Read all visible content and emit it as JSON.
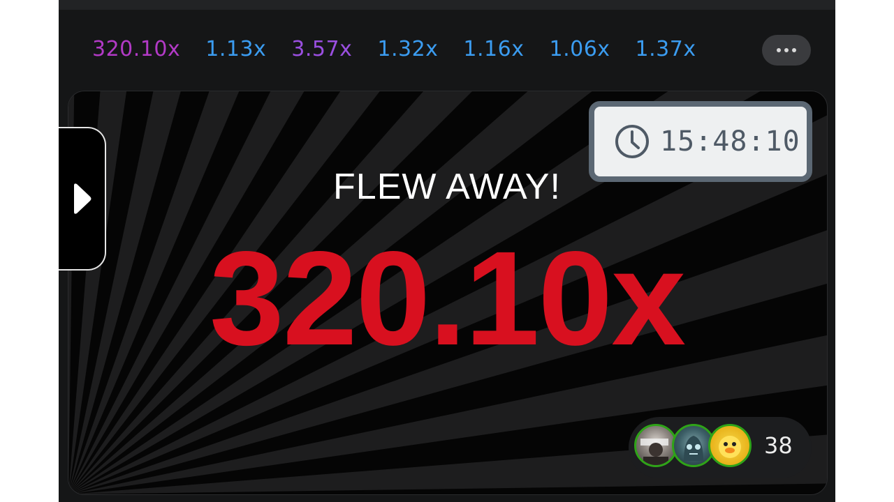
{
  "history": {
    "items": [
      {
        "value": "320.10x",
        "color": "#b23ac6"
      },
      {
        "value": "1.13x",
        "color": "#3b9cf0"
      },
      {
        "value": "3.57x",
        "color": "#9a4fe0"
      },
      {
        "value": "1.32x",
        "color": "#3b9cf0"
      },
      {
        "value": "1.16x",
        "color": "#3b9cf0"
      },
      {
        "value": "1.06x",
        "color": "#3b9cf0"
      },
      {
        "value": "1.37x",
        "color": "#3b9cf0"
      }
    ],
    "more_icon": "ellipsis-icon"
  },
  "game": {
    "status_text": "FLEW AWAY!",
    "multiplier": "320.10x",
    "multiplier_color": "#d8101f",
    "side_toggle_icon": "play-triangle-icon"
  },
  "clock": {
    "icon": "clock-icon",
    "time": "15:48:10"
  },
  "players": {
    "count": "38",
    "avatars": [
      "avatar-1",
      "avatar-2",
      "avatar-3"
    ]
  }
}
